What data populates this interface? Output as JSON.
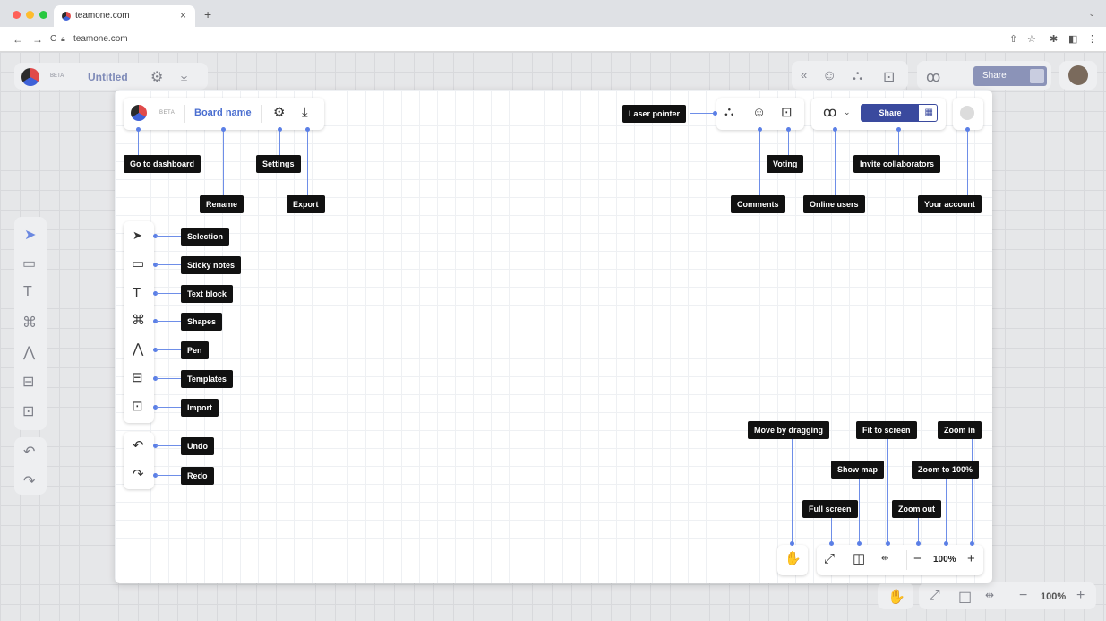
{
  "browser": {
    "tab_title": "teamone.com",
    "tab_close": "×",
    "new_tab": "+",
    "tab_menu": "⌄",
    "url": "teamone.com",
    "nav": {
      "back": "←",
      "forward": "→",
      "reload": "C"
    },
    "extensions": [
      "⇧",
      "☆",
      "✱",
      "◧",
      "⋮"
    ]
  },
  "background_app": {
    "beta": "BETA",
    "board_name": "Untitled",
    "share_label": "Share",
    "zoom_level": "100%",
    "zoom_out": "−",
    "zoom_in": "+"
  },
  "header": {
    "beta": "BETA",
    "board_name": "Board name",
    "share_label": "Share"
  },
  "bottom_bar": {
    "zoom_level": "100%",
    "zoom_out": "−",
    "zoom_in": "+"
  },
  "callouts": {
    "go_to_dashboard": "Go to dashboard",
    "rename": "Rename",
    "settings": "Settings",
    "export": "Export",
    "laser_pointer": "Laser pointer",
    "voting": "Voting",
    "invite_collaborators": "Invite collaborators",
    "comments": "Comments",
    "online_users": "Online users",
    "your_account": "Your account",
    "selection": "Selection",
    "sticky_notes": "Sticky notes",
    "text_block": "Text block",
    "shapes": "Shapes",
    "pen": "Pen",
    "templates": "Templates",
    "import": "Import",
    "undo": "Undo",
    "redo": "Redo",
    "move_by_dragging": "Move by dragging",
    "fit_to_screen": "Fit to screen",
    "zoom_in": "Zoom in",
    "show_map": "Show map",
    "zoom_to_100": "Zoom to 100%",
    "full_screen": "Full screen",
    "zoom_out": "Zoom out"
  },
  "icons": {
    "settings": "⚙",
    "export": "⤓",
    "back": "«",
    "comment": "☺",
    "laser": "⛬",
    "vote": "⊡",
    "users": "ꝏ",
    "chevron": "⌄",
    "qr": "▦",
    "pointer": "➤",
    "sticky": "▭",
    "text": "T",
    "shapes": "⌘",
    "pen": "⋀",
    "templates": "⊟",
    "import": "⊡",
    "undo": "↶",
    "redo": "↷",
    "hand": "✋",
    "expand": "⤢",
    "map": "◫",
    "fit": "⇹"
  },
  "colors": {
    "accent": "#3a4a9e",
    "board_name": "#4a6ed0",
    "callout_bg": "#111111",
    "connector": "#6e8ee8"
  }
}
